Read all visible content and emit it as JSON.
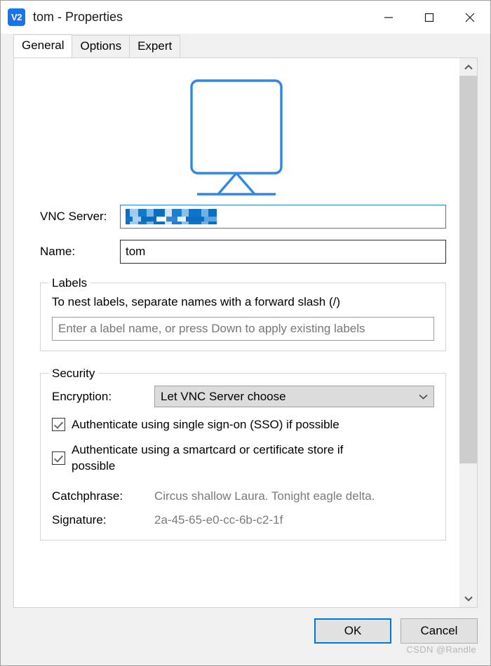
{
  "window": {
    "title": "tom - Properties",
    "app_icon": "vnc-logo-icon",
    "icon_text": "V2",
    "minimize_label": "Minimize",
    "maximize_label": "Maximize",
    "close_label": "Close"
  },
  "tabs": [
    {
      "label": "General",
      "active": true
    },
    {
      "label": "Options",
      "active": false
    },
    {
      "label": "Expert",
      "active": false
    }
  ],
  "main": {
    "monitor_icon": "desktop-monitor-icon",
    "monitor_icon_color": "#2f87e8",
    "vnc_server": {
      "label": "VNC Server:",
      "value": "",
      "redacted": true,
      "focused": true
    },
    "name": {
      "label": "Name:",
      "value": "tom"
    },
    "labels_group": {
      "title": "Labels",
      "hint": "To nest labels, separate names with a forward slash (/)",
      "input_value": "",
      "input_placeholder": "Enter a label name, or press Down to apply existing labels"
    },
    "security_group": {
      "title": "Security",
      "encryption": {
        "label": "Encryption:",
        "selected": "Let VNC Server choose",
        "chevron": "chevron-down-icon"
      },
      "checkbox_sso": {
        "label": "Authenticate using single sign-on (SSO) if possible",
        "checked": true
      },
      "checkbox_smartcard": {
        "label": "Authenticate using a smartcard or certificate store if possible",
        "checked": true
      },
      "catchphrase": {
        "label": "Catchphrase:",
        "value": "Circus shallow Laura. Tonight eagle delta."
      },
      "signature": {
        "label": "Signature:",
        "value": "2a-45-65-e0-cc-6b-c2-1f"
      }
    }
  },
  "scrollbar": {
    "up_arrow": "chevron-up-icon",
    "down_arrow": "chevron-down-icon"
  },
  "footer": {
    "ok_label": "OK",
    "cancel_label": "Cancel",
    "watermark": "CSDN @Randle"
  },
  "colors": {
    "accent": "#0078d7",
    "icon_blue": "#2f87e8",
    "muted_text": "#7a7a7a",
    "window_bg": "#f0f0f0"
  }
}
